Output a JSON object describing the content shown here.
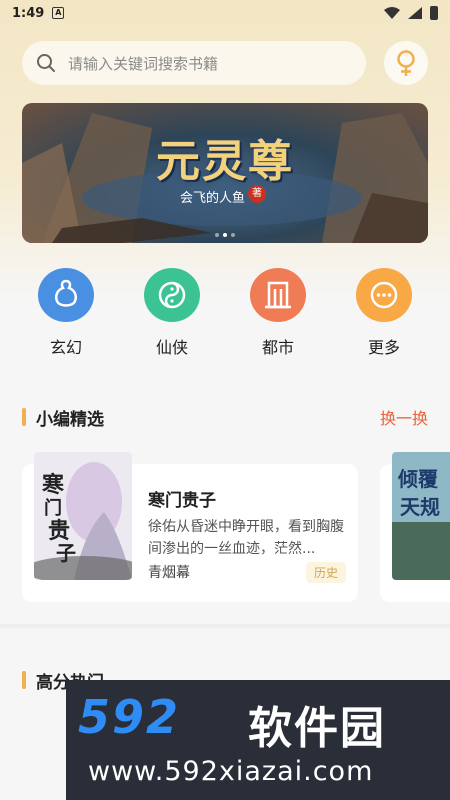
{
  "status_bar": {
    "time": "1:49",
    "notification_letter": "A"
  },
  "search": {
    "placeholder": "请输入关键词搜索书籍"
  },
  "banner": {
    "title": "元灵尊",
    "author": "会飞的人鱼",
    "author_badge": "著",
    "dots": 3,
    "active_dot": 1
  },
  "categories": [
    {
      "label": "玄幻",
      "icon": "gourd-icon",
      "color": "#4a90e2"
    },
    {
      "label": "仙侠",
      "icon": "taiji-icon",
      "color": "#3cc394"
    },
    {
      "label": "都市",
      "icon": "building-icon",
      "color": "#f07c55"
    },
    {
      "label": "更多",
      "icon": "more-dots-icon",
      "color": "#f8a845"
    }
  ],
  "editor_picks": {
    "title": "小编精选",
    "action": "换一换",
    "book": {
      "title": "寒门贵子",
      "description": "徐佑从昏迷中睁开眼，看到胸腹间渗出的一丝血迹，茫然...",
      "author": "青烟幕",
      "tag": "历史",
      "cover_text": "寒门贵子"
    },
    "next_book": {
      "cover_text": "倾覆天规"
    }
  },
  "high_score": {
    "title": "高分热门"
  },
  "watermark": {
    "brand_num": "592",
    "brand_cn": "软件园",
    "url": "www.592xiazai.com"
  },
  "colors": {
    "accent": "#f0b04e",
    "action": "#e8633a"
  }
}
